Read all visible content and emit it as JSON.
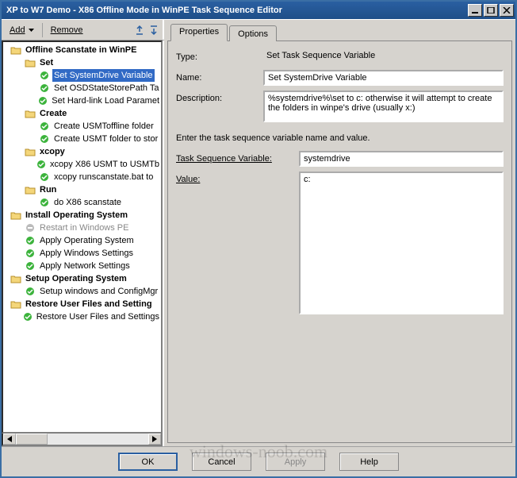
{
  "window": {
    "title": "XP to W7 Demo - X86 Offline Mode in WinPE Task Sequence Editor"
  },
  "toolbar": {
    "add": "Add",
    "remove": "Remove"
  },
  "tree": [
    {
      "d": 0,
      "t": "group",
      "label": "Offline Scanstate in WinPE",
      "sel": false
    },
    {
      "d": 1,
      "t": "group",
      "label": "Set",
      "sel": false
    },
    {
      "d": 2,
      "t": "step",
      "label": "Set SystemDrive Variable",
      "sel": true
    },
    {
      "d": 2,
      "t": "step",
      "label": "Set OSDStateStorePath Ta",
      "sel": false
    },
    {
      "d": 2,
      "t": "step",
      "label": "Set Hard-link Load Paramet",
      "sel": false
    },
    {
      "d": 1,
      "t": "group",
      "label": "Create",
      "sel": false
    },
    {
      "d": 2,
      "t": "step",
      "label": "Create USMToffline folder",
      "sel": false
    },
    {
      "d": 2,
      "t": "step",
      "label": "Create USMT folder to stor",
      "sel": false
    },
    {
      "d": 1,
      "t": "group",
      "label": "xcopy",
      "sel": false
    },
    {
      "d": 2,
      "t": "step",
      "label": "xcopy X86 USMT to USMTb",
      "sel": false
    },
    {
      "d": 2,
      "t": "step",
      "label": "xcopy runscanstate.bat to",
      "sel": false
    },
    {
      "d": 1,
      "t": "group",
      "label": "Run",
      "sel": false
    },
    {
      "d": 2,
      "t": "step",
      "label": "do X86 scanstate",
      "sel": false
    },
    {
      "d": 0,
      "t": "group",
      "label": "Install Operating System",
      "sel": false
    },
    {
      "d": 1,
      "t": "disabled",
      "label": "Restart in Windows PE",
      "sel": false
    },
    {
      "d": 1,
      "t": "step",
      "label": "Apply Operating System",
      "sel": false
    },
    {
      "d": 1,
      "t": "step",
      "label": "Apply Windows Settings",
      "sel": false
    },
    {
      "d": 1,
      "t": "step",
      "label": "Apply Network Settings",
      "sel": false
    },
    {
      "d": 0,
      "t": "group",
      "label": "Setup Operating System",
      "sel": false
    },
    {
      "d": 1,
      "t": "step",
      "label": "Setup windows and ConfigMgr",
      "sel": false
    },
    {
      "d": 0,
      "t": "group",
      "label": "Restore User Files and Setting",
      "sel": false
    },
    {
      "d": 1,
      "t": "step",
      "label": "Restore User Files and Settings",
      "sel": false
    }
  ],
  "tabs": {
    "properties": "Properties",
    "options": "Options"
  },
  "prop": {
    "type_label": "Type:",
    "type_value": "Set Task Sequence Variable",
    "name_label": "Name:",
    "name_value": "Set SystemDrive Variable",
    "desc_label": "Description:",
    "desc_value": "%systemdrive%\\set to c: otherwise it will attempt to create the folders in winpe's drive (usually x:)",
    "hint": "Enter the task sequence variable name and value.",
    "var_label": "Task Sequence Variable:",
    "var_value": "systemdrive",
    "val_label": "Value:",
    "val_value": "c:"
  },
  "buttons": {
    "ok": "OK",
    "cancel": "Cancel",
    "apply": "Apply",
    "help": "Help"
  },
  "watermark": "windows-noob.com"
}
